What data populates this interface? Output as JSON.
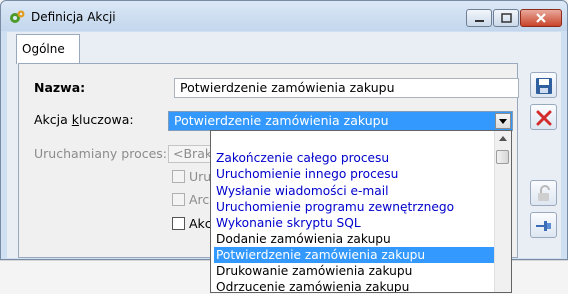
{
  "window": {
    "title": "Definicja Akcji",
    "icon": "gear-icon"
  },
  "tabs": [
    {
      "label": "Ogólne",
      "active": true
    }
  ],
  "form": {
    "name_label": "Nazwa:",
    "name_value": "Potwierdzenie zamówienia zakupu",
    "key_action_label": "Akcja kluczowa:",
    "key_action_value": "Potwierdzenie zamówienia zakupu",
    "process_label": "Uruchamiany proces:",
    "process_value": "<Brak>",
    "checkbox1_label": "Uruc",
    "checkbox2_label": "Arch",
    "checkbox3_label": "Akcj"
  },
  "dropdown": {
    "items": [
      {
        "label": "Zakończenie całego procesu",
        "color": "#0000cc",
        "selected": false
      },
      {
        "label": "Uruchomienie innego procesu",
        "color": "#0000cc",
        "selected": false
      },
      {
        "label": "Wysłanie wiadomości e-mail",
        "color": "#0000cc",
        "selected": false
      },
      {
        "label": "Uruchomienie programu zewnętrznego",
        "color": "#0000cc",
        "selected": false
      },
      {
        "label": "Wykonanie skryptu SQL",
        "color": "#0000cc",
        "selected": false
      },
      {
        "label": "Dodanie zamówienia zakupu",
        "color": "#000000",
        "selected": false
      },
      {
        "label": "Potwierdzenie zamówienia zakupu",
        "color": "#ffffff",
        "selected": true
      },
      {
        "label": "Drukowanie zamówienia zakupu",
        "color": "#000000",
        "selected": false
      },
      {
        "label": "Odrzucenie zamówienia zakupu",
        "color": "#000000",
        "selected": false
      }
    ]
  },
  "side_buttons": [
    "save-icon",
    "cancel-icon",
    "lock-icon",
    "pin-icon"
  ],
  "colors": {
    "selection": "#3399ff",
    "link_items": "#0000cc",
    "cancel_red": "#d22b2b",
    "save_blue": "#2f5f9e"
  }
}
